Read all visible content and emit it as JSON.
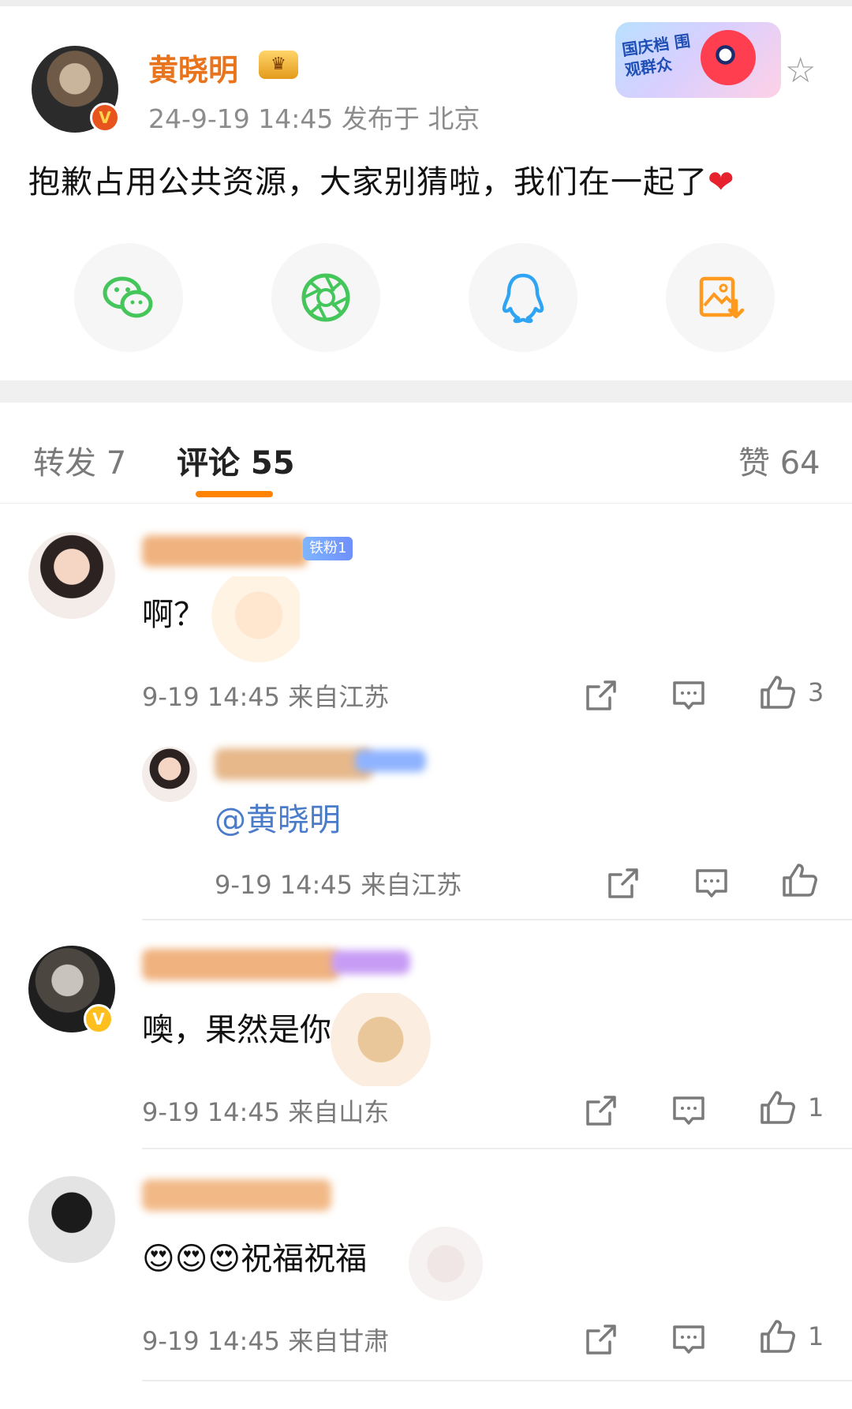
{
  "post": {
    "author": "黄晓明",
    "meta": "24-9-19 14:45  发布于 北京",
    "text": "抱歉占用公共资源，大家别猜啦，我们在一起了",
    "heart": "❤",
    "verify_mark": "V",
    "banner_text": "国庆档 围观群众",
    "star_icon": "☆"
  },
  "share": [
    {
      "icon": "wechat-icon",
      "color": "#45c65a"
    },
    {
      "icon": "moments-icon",
      "color": "#45c65a"
    },
    {
      "icon": "qq-icon",
      "color": "#2fa4f3"
    },
    {
      "icon": "save-image-icon",
      "color": "#ff9a1f"
    }
  ],
  "tabs": {
    "repost": "转发 7",
    "comments": "评论 55",
    "likes": "赞 64",
    "accent": "#ff8200"
  },
  "comments": [
    {
      "text": "啊？",
      "meta": "9-19 14:45  来自江苏",
      "likes": "3",
      "badge": "铁粉1"
    },
    {
      "mention": "@黄晓明",
      "meta": "9-19 14:45  来自江苏",
      "likes": ""
    },
    {
      "text": "噢，果然是你",
      "meta": "9-19 14:45  来自山东",
      "likes": "1"
    },
    {
      "text": "😍😍😍祝福祝福",
      "meta": "9-19 14:45  来自甘肃",
      "likes": "1"
    }
  ]
}
